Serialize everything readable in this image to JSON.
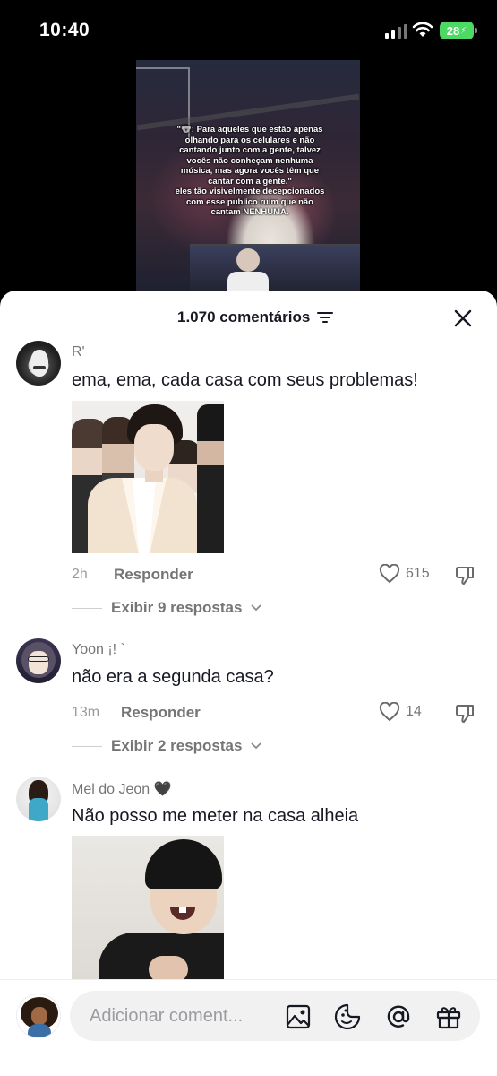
{
  "status_bar": {
    "time": "10:40",
    "battery": "28"
  },
  "video": {
    "caption_lines": [
      "\"🐨: Para aqueles que estão apenas",
      "olhando para os celulares e não",
      "cantando junto com a gente, talvez",
      "vocês não conheçam nenhuma",
      "música, mas agora vocês têm que",
      "cantar com a gente.\"",
      "eles tão visivelmente decepcionados",
      "com esse publico ruim que não",
      "cantam NENHUMA."
    ]
  },
  "comments_sheet": {
    "count_label": "1.070 comentários",
    "comments": [
      {
        "username": "R'",
        "text": "ema, ema, cada casa com seus problemas!",
        "time": "2h",
        "reply_label": "Responder",
        "likes": "615",
        "view_replies": "Exibir 9 respostas"
      },
      {
        "username": "Yoon ¡! `",
        "text": "não era a segunda casa?",
        "time": "13m",
        "reply_label": "Responder",
        "likes": "14",
        "view_replies": "Exibir 2 respostas"
      },
      {
        "username": "Mel do Jeon 🖤",
        "text": "Não posso me meter na casa alheia"
      }
    ]
  },
  "input_bar": {
    "placeholder": "Adicionar coment..."
  },
  "colors": {
    "text_primary": "#161823",
    "text_secondary": "#757575",
    "battery_green": "#4cd964"
  }
}
